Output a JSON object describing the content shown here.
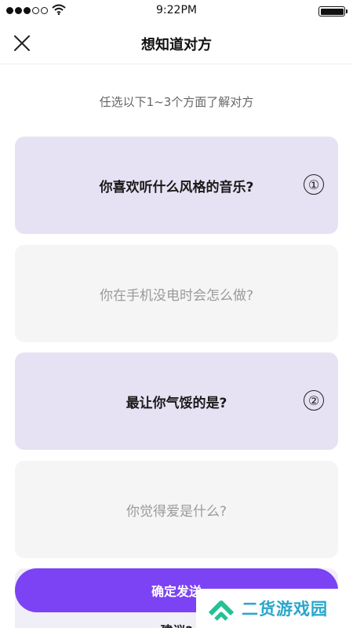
{
  "status_bar": {
    "time": "9:22PM",
    "signal_bars_filled": 3,
    "signal_bars_total": 5
  },
  "nav": {
    "title": "想知道对方",
    "close_icon": "close-icon"
  },
  "subtitle": "任选以下1~3个方面了解对方",
  "options": [
    {
      "text": "你喜欢听什么风格的音乐?",
      "selected": true,
      "order": "①"
    },
    {
      "text": "你在手机没电时会怎么做?",
      "selected": false,
      "order": ""
    },
    {
      "text": "最让你气馁的是?",
      "selected": true,
      "order": "②"
    },
    {
      "text": "你觉得爱是什么?",
      "selected": false,
      "order": ""
    }
  ],
  "hidden_option_text": "建议?",
  "confirm_button": "确定发送",
  "watermark": {
    "text": "二货游戏园"
  },
  "colors": {
    "accent": "#7b43f3",
    "selected_card": "#e6e2f3",
    "unselected_card": "#f5f5f5",
    "watermark_text": "#2aa6c9",
    "watermark_logo": "#24c096"
  }
}
